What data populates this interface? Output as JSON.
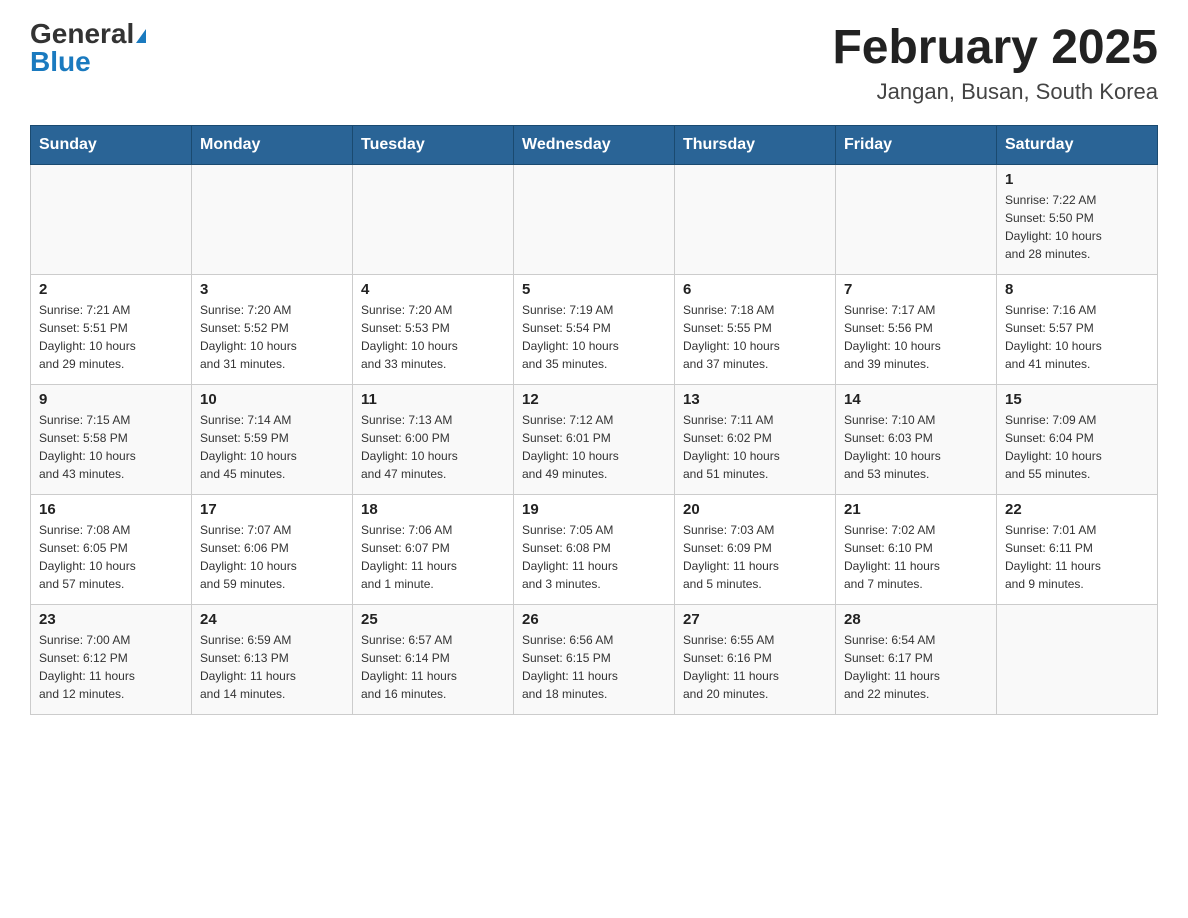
{
  "logo": {
    "general": "General",
    "blue": "Blue"
  },
  "title": "February 2025",
  "subtitle": "Jangan, Busan, South Korea",
  "weekdays": [
    "Sunday",
    "Monday",
    "Tuesday",
    "Wednesday",
    "Thursday",
    "Friday",
    "Saturday"
  ],
  "weeks": [
    [
      {
        "day": "",
        "info": ""
      },
      {
        "day": "",
        "info": ""
      },
      {
        "day": "",
        "info": ""
      },
      {
        "day": "",
        "info": ""
      },
      {
        "day": "",
        "info": ""
      },
      {
        "day": "",
        "info": ""
      },
      {
        "day": "1",
        "info": "Sunrise: 7:22 AM\nSunset: 5:50 PM\nDaylight: 10 hours\nand 28 minutes."
      }
    ],
    [
      {
        "day": "2",
        "info": "Sunrise: 7:21 AM\nSunset: 5:51 PM\nDaylight: 10 hours\nand 29 minutes."
      },
      {
        "day": "3",
        "info": "Sunrise: 7:20 AM\nSunset: 5:52 PM\nDaylight: 10 hours\nand 31 minutes."
      },
      {
        "day": "4",
        "info": "Sunrise: 7:20 AM\nSunset: 5:53 PM\nDaylight: 10 hours\nand 33 minutes."
      },
      {
        "day": "5",
        "info": "Sunrise: 7:19 AM\nSunset: 5:54 PM\nDaylight: 10 hours\nand 35 minutes."
      },
      {
        "day": "6",
        "info": "Sunrise: 7:18 AM\nSunset: 5:55 PM\nDaylight: 10 hours\nand 37 minutes."
      },
      {
        "day": "7",
        "info": "Sunrise: 7:17 AM\nSunset: 5:56 PM\nDaylight: 10 hours\nand 39 minutes."
      },
      {
        "day": "8",
        "info": "Sunrise: 7:16 AM\nSunset: 5:57 PM\nDaylight: 10 hours\nand 41 minutes."
      }
    ],
    [
      {
        "day": "9",
        "info": "Sunrise: 7:15 AM\nSunset: 5:58 PM\nDaylight: 10 hours\nand 43 minutes."
      },
      {
        "day": "10",
        "info": "Sunrise: 7:14 AM\nSunset: 5:59 PM\nDaylight: 10 hours\nand 45 minutes."
      },
      {
        "day": "11",
        "info": "Sunrise: 7:13 AM\nSunset: 6:00 PM\nDaylight: 10 hours\nand 47 minutes."
      },
      {
        "day": "12",
        "info": "Sunrise: 7:12 AM\nSunset: 6:01 PM\nDaylight: 10 hours\nand 49 minutes."
      },
      {
        "day": "13",
        "info": "Sunrise: 7:11 AM\nSunset: 6:02 PM\nDaylight: 10 hours\nand 51 minutes."
      },
      {
        "day": "14",
        "info": "Sunrise: 7:10 AM\nSunset: 6:03 PM\nDaylight: 10 hours\nand 53 minutes."
      },
      {
        "day": "15",
        "info": "Sunrise: 7:09 AM\nSunset: 6:04 PM\nDaylight: 10 hours\nand 55 minutes."
      }
    ],
    [
      {
        "day": "16",
        "info": "Sunrise: 7:08 AM\nSunset: 6:05 PM\nDaylight: 10 hours\nand 57 minutes."
      },
      {
        "day": "17",
        "info": "Sunrise: 7:07 AM\nSunset: 6:06 PM\nDaylight: 10 hours\nand 59 minutes."
      },
      {
        "day": "18",
        "info": "Sunrise: 7:06 AM\nSunset: 6:07 PM\nDaylight: 11 hours\nand 1 minute."
      },
      {
        "day": "19",
        "info": "Sunrise: 7:05 AM\nSunset: 6:08 PM\nDaylight: 11 hours\nand 3 minutes."
      },
      {
        "day": "20",
        "info": "Sunrise: 7:03 AM\nSunset: 6:09 PM\nDaylight: 11 hours\nand 5 minutes."
      },
      {
        "day": "21",
        "info": "Sunrise: 7:02 AM\nSunset: 6:10 PM\nDaylight: 11 hours\nand 7 minutes."
      },
      {
        "day": "22",
        "info": "Sunrise: 7:01 AM\nSunset: 6:11 PM\nDaylight: 11 hours\nand 9 minutes."
      }
    ],
    [
      {
        "day": "23",
        "info": "Sunrise: 7:00 AM\nSunset: 6:12 PM\nDaylight: 11 hours\nand 12 minutes."
      },
      {
        "day": "24",
        "info": "Sunrise: 6:59 AM\nSunset: 6:13 PM\nDaylight: 11 hours\nand 14 minutes."
      },
      {
        "day": "25",
        "info": "Sunrise: 6:57 AM\nSunset: 6:14 PM\nDaylight: 11 hours\nand 16 minutes."
      },
      {
        "day": "26",
        "info": "Sunrise: 6:56 AM\nSunset: 6:15 PM\nDaylight: 11 hours\nand 18 minutes."
      },
      {
        "day": "27",
        "info": "Sunrise: 6:55 AM\nSunset: 6:16 PM\nDaylight: 11 hours\nand 20 minutes."
      },
      {
        "day": "28",
        "info": "Sunrise: 6:54 AM\nSunset: 6:17 PM\nDaylight: 11 hours\nand 22 minutes."
      },
      {
        "day": "",
        "info": ""
      }
    ]
  ]
}
